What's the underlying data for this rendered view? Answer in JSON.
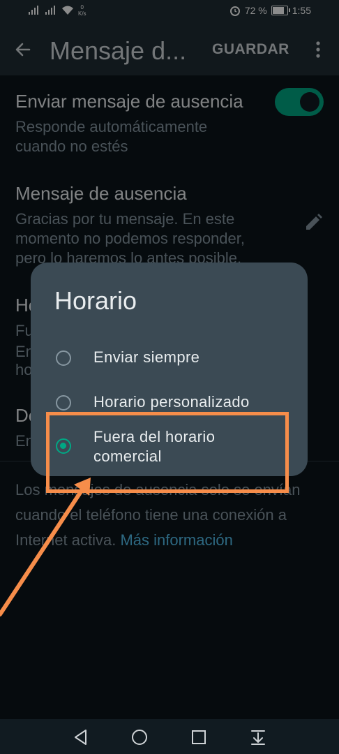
{
  "status_bar": {
    "net_speed_value": "0",
    "net_speed_unit": "K/s",
    "battery": "72 %",
    "time": "1:55"
  },
  "app_bar": {
    "title": "Mensaje d...",
    "save_label": "GUARDAR"
  },
  "settings": {
    "away": {
      "title": "Enviar mensaje de ausencia",
      "subtitle": "Responde automáticamente\ncuando no estés",
      "enabled": true
    },
    "message": {
      "title": "Mensaje de ausencia",
      "subtitle": "Gracias por tu mensaje. En este\nmomento no podemos responder,\npero lo haremos lo antes posible."
    },
    "schedule_partial": {
      "title": "Ho",
      "line1": "Fu",
      "line2": "En",
      "line3": "ho"
    },
    "recipients_partial": {
      "title": "De",
      "line1": "En"
    },
    "info_text": "Los mensajes de ausencia solo se envían cuando el teléfono tiene una conexión a Internet activa.",
    "info_link": "Más información"
  },
  "dialog": {
    "title": "Horario",
    "options": [
      {
        "label": "Enviar siempre",
        "selected": false
      },
      {
        "label": "Horario personalizado",
        "selected": false
      },
      {
        "label": "Fuera del horario\ncomercial",
        "selected": true
      }
    ]
  },
  "colors": {
    "accent": "#00a884",
    "annotation": "#f68d4a",
    "link": "#53bdeb"
  }
}
